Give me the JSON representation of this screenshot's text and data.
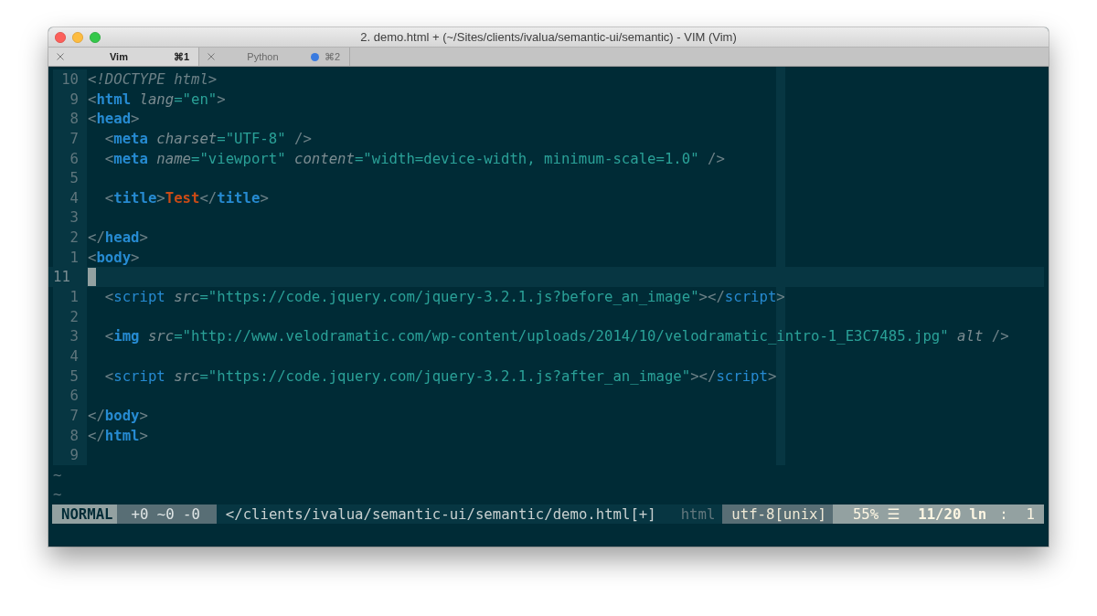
{
  "window": {
    "title": "2. demo.html + (~/Sites/clients/ivalua/semantic-ui/semantic) - VIM (Vim)"
  },
  "tabs": [
    {
      "label": "Vim",
      "shortcut": "⌘1",
      "selected": true,
      "activity": false
    },
    {
      "label": "Python",
      "shortcut": "⌘2",
      "selected": false,
      "activity": true
    }
  ],
  "editor": {
    "lines": [
      {
        "number": "10",
        "current": false,
        "tokens": [
          {
            "kind": "doctype",
            "text": "<!DOCTYPE html>"
          }
        ]
      },
      {
        "number": "9",
        "current": false,
        "tokens": [
          {
            "kind": "punct",
            "text": "<"
          },
          {
            "kind": "tag",
            "text": "html"
          },
          {
            "kind": "attr",
            "text": " lang"
          },
          {
            "kind": "string",
            "text": "=\"en\""
          },
          {
            "kind": "punct",
            "text": ">"
          }
        ]
      },
      {
        "number": "8",
        "current": false,
        "tokens": [
          {
            "kind": "punct",
            "text": "<"
          },
          {
            "kind": "tag",
            "text": "head"
          },
          {
            "kind": "punct",
            "text": ">"
          }
        ]
      },
      {
        "number": "7",
        "current": false,
        "tokens": [
          {
            "kind": "punct",
            "text": "  <"
          },
          {
            "kind": "tag",
            "text": "meta"
          },
          {
            "kind": "attr",
            "text": " charset"
          },
          {
            "kind": "string",
            "text": "=\"UTF-8\""
          },
          {
            "kind": "punct",
            "text": " />"
          }
        ]
      },
      {
        "number": "6",
        "current": false,
        "tokens": [
          {
            "kind": "punct",
            "text": "  <"
          },
          {
            "kind": "tag",
            "text": "meta"
          },
          {
            "kind": "attr",
            "text": " name"
          },
          {
            "kind": "string",
            "text": "=\"viewport\""
          },
          {
            "kind": "attr",
            "text": " content"
          },
          {
            "kind": "string",
            "text": "=\"width=device-width, minimum-scale=1.0\""
          },
          {
            "kind": "punct",
            "text": " />"
          }
        ]
      },
      {
        "number": "5",
        "current": false
      },
      {
        "number": "4",
        "current": false,
        "tokens": [
          {
            "kind": "punct",
            "text": "  <"
          },
          {
            "kind": "tag",
            "text": "title"
          },
          {
            "kind": "punct",
            "text": ">"
          },
          {
            "kind": "text",
            "text": "Test"
          },
          {
            "kind": "punct",
            "text": "</"
          },
          {
            "kind": "tag",
            "text": "title"
          },
          {
            "kind": "punct",
            "text": ">"
          }
        ]
      },
      {
        "number": "3",
        "current": false
      },
      {
        "number": "2",
        "current": false,
        "tokens": [
          {
            "kind": "punct",
            "text": "</"
          },
          {
            "kind": "tag",
            "text": "head"
          },
          {
            "kind": "punct",
            "text": ">"
          }
        ]
      },
      {
        "number": "1",
        "current": false,
        "tokens": [
          {
            "kind": "punct",
            "text": "<"
          },
          {
            "kind": "tag",
            "text": "body"
          },
          {
            "kind": "punct",
            "text": ">"
          }
        ]
      },
      {
        "number": "11",
        "current": true
      },
      {
        "number": "1",
        "current": false,
        "tokens": [
          {
            "kind": "punct",
            "text": "  <"
          },
          {
            "kind": "script",
            "text": "script"
          },
          {
            "kind": "attr",
            "text": " src"
          },
          {
            "kind": "string",
            "text": "=\"https://code.jquery.com/jquery-3.2.1.js?before_an_image\""
          },
          {
            "kind": "punct",
            "text": "></"
          },
          {
            "kind": "script",
            "text": "script"
          },
          {
            "kind": "punct",
            "text": ">"
          }
        ]
      },
      {
        "number": "2",
        "current": false
      },
      {
        "number": "3",
        "current": false,
        "tokens": [
          {
            "kind": "punct",
            "text": "  <"
          },
          {
            "kind": "tag",
            "text": "img"
          },
          {
            "kind": "attr",
            "text": " src"
          },
          {
            "kind": "string",
            "text": "=\"http://www.velodramatic.com/wp-content/uploads/2014/10/velodramatic_intro-1_E3C7485.jpg\""
          },
          {
            "kind": "attr",
            "text": " alt"
          },
          {
            "kind": "punct",
            "text": " />"
          }
        ]
      },
      {
        "number": "4",
        "current": false
      },
      {
        "number": "5",
        "current": false,
        "tokens": [
          {
            "kind": "punct",
            "text": "  <"
          },
          {
            "kind": "script",
            "text": "script"
          },
          {
            "kind": "attr",
            "text": " src"
          },
          {
            "kind": "string",
            "text": "=\"https://code.jquery.com/jquery-3.2.1.js?after_an_image\""
          },
          {
            "kind": "punct",
            "text": "></"
          },
          {
            "kind": "script",
            "text": "script"
          },
          {
            "kind": "punct",
            "text": ">"
          }
        ]
      },
      {
        "number": "6",
        "current": false
      },
      {
        "number": "7",
        "current": false,
        "tokens": [
          {
            "kind": "punct",
            "text": "</"
          },
          {
            "kind": "tag",
            "text": "body"
          },
          {
            "kind": "punct",
            "text": ">"
          }
        ]
      },
      {
        "number": "8",
        "current": false,
        "tokens": [
          {
            "kind": "punct",
            "text": "</"
          },
          {
            "kind": "tag",
            "text": "html"
          },
          {
            "kind": "punct",
            "text": ">"
          }
        ]
      },
      {
        "number": "9",
        "current": false
      }
    ],
    "filler": [
      "~",
      "~"
    ]
  },
  "status_line": {
    "mode": "NORMAL",
    "changes": "+0 ~0 -0",
    "file": "</clients/ivalua/semantic-ui/semantic/demo.html[+]",
    "filetype": "html",
    "encoding": "utf-8[unix]",
    "percent": "55%",
    "line_symbol": "☰",
    "line": "11/20",
    "line_label": "ln",
    "separator": ":",
    "column": "1"
  }
}
